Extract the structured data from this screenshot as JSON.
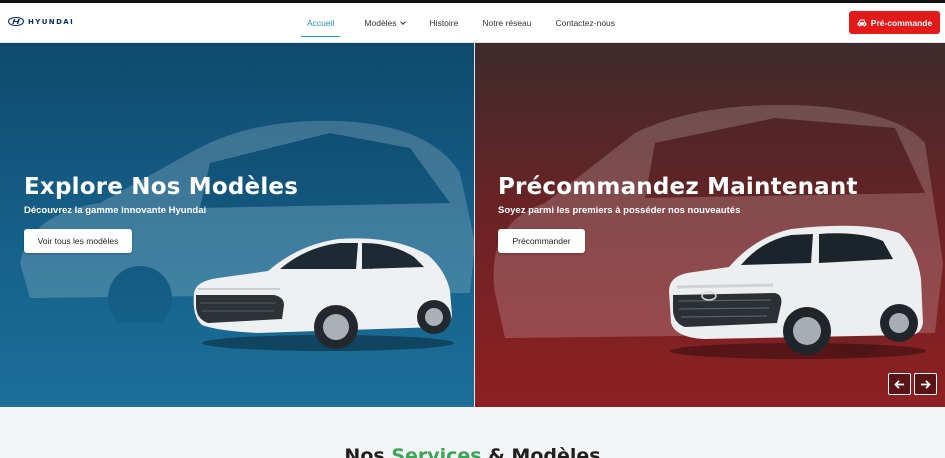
{
  "brand": {
    "name": "HYUNDAI",
    "logo_icon": "hyundai-logo-icon",
    "color": "#0b2d5b"
  },
  "nav": {
    "items": [
      {
        "label": "Accueil",
        "active": true
      },
      {
        "label": "Modèles",
        "has_dropdown": true
      },
      {
        "label": "Histoire"
      },
      {
        "label": "Notre réseau"
      },
      {
        "label": "Contactez-nous"
      }
    ],
    "active_color": "#2693c6",
    "cta": {
      "label": "Pré-commande",
      "icon": "car-icon",
      "color": "#e31a1a"
    }
  },
  "hero": {
    "left": {
      "title": "Explore Nos Modèles",
      "subtitle": "Découvrez la gamme innovante Hyundai",
      "button": "Voir tous les modèles",
      "background": "#15618a"
    },
    "right": {
      "title": "Précommandez Maintenant",
      "subtitle": "Soyez parmi les premiers à posséder nos nouveautés",
      "button": "Précommander",
      "background": "#8e2022"
    },
    "prev_icon": "arrow-left-icon",
    "next_icon": "arrow-right-icon"
  },
  "section": {
    "title_part1": "Nos ",
    "title_accent": "Services",
    "title_part2": " & Modèles",
    "accent_color": "#3aa655"
  }
}
